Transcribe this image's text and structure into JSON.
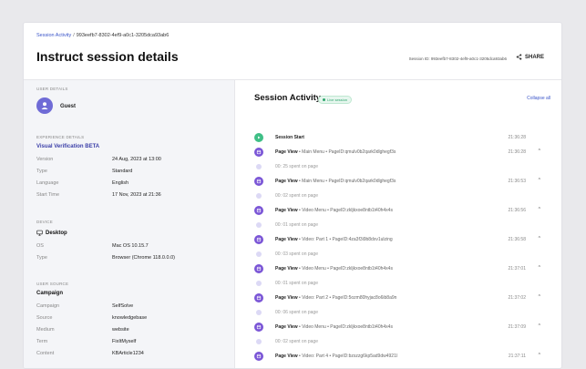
{
  "breadcrumb": {
    "root": "Session Activity",
    "separator": "/",
    "current": "993eefb7-8302-4ef9-a0c1-3205dca93ab6"
  },
  "header": {
    "title": "Instruct session details",
    "session_id": "Session ID: 993eefb7-8302-4ef9-a0c1-3205dca93ab6",
    "share_label": "SHARE"
  },
  "user": {
    "section": "USER DETAILS",
    "name": "Guest"
  },
  "experience": {
    "section": "EXPERIENCE DETAILS",
    "name": "Visual Verification BETA",
    "rows": [
      {
        "key": "Version",
        "value": "24 Aug, 2023 at 13:00"
      },
      {
        "key": "Type",
        "value": "Standard"
      },
      {
        "key": "Language",
        "value": "English"
      },
      {
        "key": "Start Time",
        "value": "17 Nov, 2023 at 21:36"
      }
    ]
  },
  "device": {
    "section": "DEVICE",
    "name": "Desktop",
    "rows": [
      {
        "key": "OS",
        "value": "Mac OS 10.15.7"
      },
      {
        "key": "Type",
        "value": "Browser (Chrome 118.0.0.0)"
      }
    ]
  },
  "source": {
    "section": "USER SOURCE",
    "name": "Campaign",
    "rows": [
      {
        "key": "Campaign",
        "value": "SelfSolve"
      },
      {
        "key": "Source",
        "value": "knowledgebase"
      },
      {
        "key": "Medium",
        "value": "website"
      },
      {
        "key": "Term",
        "value": "FixItMyself"
      },
      {
        "key": "Content",
        "value": "KBArticle1234"
      }
    ]
  },
  "activity": {
    "title": "Session Activity",
    "badge": "Live session",
    "collapse": "Collapse all",
    "items": [
      {
        "kind": "start",
        "label": "Session Start",
        "path": "",
        "time": "21:36:28",
        "caret": ""
      },
      {
        "kind": "page",
        "label": "Page View",
        "path": " • Main Menu • PageID:qmulv0b2qark0dlghegf3s",
        "time": "21:36:28",
        "caret": "^"
      },
      {
        "kind": "spent",
        "label": "00: 25 spent on page",
        "path": "",
        "time": "",
        "caret": ""
      },
      {
        "kind": "page",
        "label": "Page View",
        "path": " • Main Menu • PageID:qmulv0b2qark0dlghegf3s",
        "time": "21:36:53",
        "caret": "^"
      },
      {
        "kind": "spent",
        "label": "00: 02 spent on page",
        "path": "",
        "time": "",
        "caret": ""
      },
      {
        "kind": "page",
        "label": "Page View",
        "path": " • Video Menu • PageID:zkljkxoe8ntb1t40h4x4s",
        "time": "21:36:56",
        "caret": "^"
      },
      {
        "kind": "spent",
        "label": "00: 01 spent on page",
        "path": "",
        "time": "",
        "caret": ""
      },
      {
        "kind": "page",
        "label": "Page View",
        "path": " • Video: Part 1 • PageID:4za3f3i9b8dxv1ulzing",
        "time": "21:36:58",
        "caret": "^"
      },
      {
        "kind": "spent",
        "label": "00: 03 spent on page",
        "path": "",
        "time": "",
        "caret": ""
      },
      {
        "kind": "page",
        "label": "Page View",
        "path": " • Video Menu • PageID:zkljkxoe8ntb1t40h4x4s",
        "time": "21:37:01",
        "caret": "^"
      },
      {
        "kind": "spent",
        "label": "00: 01 spent on page",
        "path": "",
        "time": "",
        "caret": ""
      },
      {
        "kind": "page",
        "label": "Page View",
        "path": " • Video: Part 2 • PageID:5ozm80hyjac8o6ib8a9n",
        "time": "21:37:02",
        "caret": "^"
      },
      {
        "kind": "spent",
        "label": "00: 06 spent on page",
        "path": "",
        "time": "",
        "caret": ""
      },
      {
        "kind": "page",
        "label": "Page View",
        "path": " • Video Menu • PageID:zkljkxoe8ntb1t40h4x4s",
        "time": "21:37:09",
        "caret": "^"
      },
      {
        "kind": "spent",
        "label": "00: 02 spent on page",
        "path": "",
        "time": "",
        "caret": ""
      },
      {
        "kind": "page",
        "label": "Page View",
        "path": " • Video: Part 4 • PageID:bzszzg6kp5ad9dw4921l",
        "time": "21:37:11",
        "caret": "^"
      }
    ]
  },
  "colors": {
    "accent": "#3b55c9",
    "live": "#3fbf86",
    "page_view": "#7a55d6"
  }
}
